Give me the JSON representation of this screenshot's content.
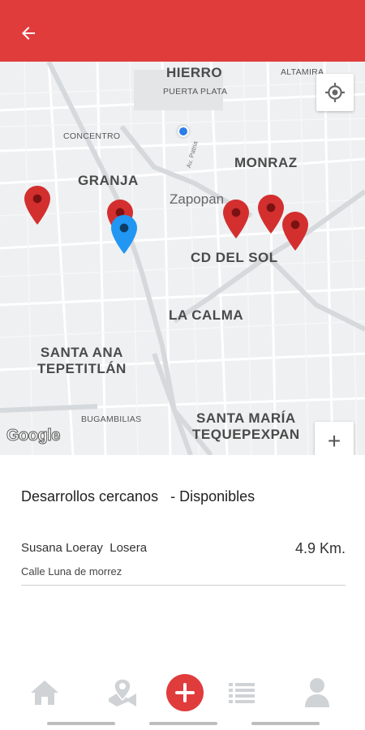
{
  "header": {
    "back_icon": "arrow-left-icon",
    "background": "#e03c3c"
  },
  "map": {
    "labels": {
      "hierro": "HIERRO",
      "altamira": "ALTAMIRA",
      "puerta_plata": "PUERTA PLATA",
      "concentro": "CONCENTRO",
      "granja": "GRANJA",
      "monraz": "MONRAZ",
      "zapopan": "Zapopan",
      "road_patria": "Av. Patria",
      "cd_del_sol": "CD DEL SOL",
      "la_calma": "LA CALMA",
      "santa_ana_1": "SANTA ANA",
      "santa_ana_2": "TEPETITLÁN",
      "bugambilias": "BUGAMBILIAS",
      "santa_maria_1": "SANTA MARÍA",
      "santa_maria_2": "TEQUEPEXPAN"
    },
    "attribution": "Google",
    "zoom_in": "+",
    "zoom_out": "−",
    "pin_color": "#d32f2f",
    "user_pin_color": "#2196f3"
  },
  "nearby": {
    "title": "Desarrollos cercanos   - Disponibles",
    "results": [
      {
        "name": "Susana Loeray  Losera",
        "address": "Calle Luna de morrez",
        "distance": "4.9 Km."
      }
    ]
  },
  "bottom_nav": {
    "items": [
      "home-icon",
      "map-pin-icon",
      "add-icon",
      "list-icon",
      "profile-icon"
    ],
    "accent": "#e03c3c"
  }
}
